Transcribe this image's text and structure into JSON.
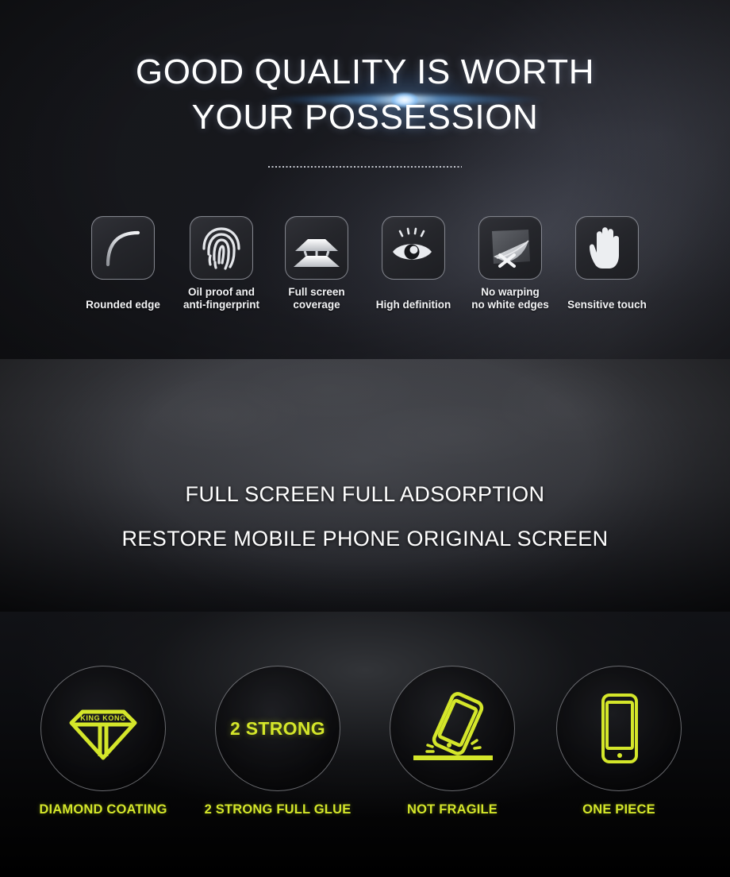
{
  "hero": {
    "title_line1": "GOOD QUALITY IS WORTH",
    "title_line2": "YOUR POSSESSION",
    "flare_color": "#78bdff",
    "features": [
      {
        "label_line1": "Rounded edge",
        "label_line2": "",
        "icon": "rounded-corner-arc-icon"
      },
      {
        "label_line1": "Oil proof and",
        "label_line2": "anti-fingerprint",
        "icon": "fingerprint-icon"
      },
      {
        "label_line1": "Full screen",
        "label_line2": "coverage",
        "icon": "layered-screen-icon"
      },
      {
        "label_line1": "High definition",
        "label_line2": "",
        "icon": "eye-icon"
      },
      {
        "label_line1": "No warping",
        "label_line2": "no white edges",
        "icon": "peeling-film-x-icon"
      },
      {
        "label_line1": "Sensitive touch",
        "label_line2": "",
        "icon": "hand-icon"
      }
    ]
  },
  "mid": {
    "line1": "FULL SCREEN FULL ADSORPTION",
    "line2": "RESTORE MOBILE PHONE ORIGINAL SCREEN"
  },
  "bottom": {
    "accent_color": "#d4e62a",
    "badges": [
      {
        "label": "DIAMOND COATING",
        "icon": "diamond-outline-icon",
        "inner_text": "KING KONG"
      },
      {
        "label": "2 STRONG FULL GLUE",
        "icon": "text-badge",
        "inner_text": "2 STRONG"
      },
      {
        "label": "NOT FRAGILE",
        "icon": "dropping-phone-icon",
        "inner_text": ""
      },
      {
        "label": "ONE PIECE",
        "icon": "phone-outline-icon",
        "inner_text": ""
      }
    ]
  }
}
